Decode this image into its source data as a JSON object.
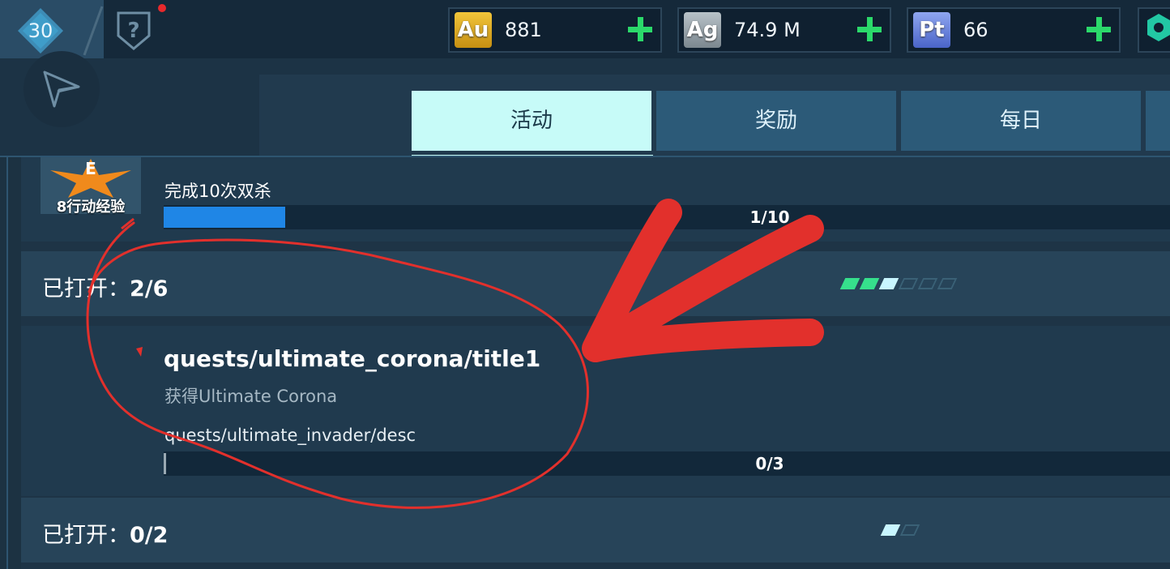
{
  "player": {
    "level": "30"
  },
  "resources": [
    {
      "symbol": "Au",
      "value": "881",
      "color": "#d6a51b"
    },
    {
      "symbol": "Ag",
      "value": "74.9 M",
      "color": "#8e9aa3"
    },
    {
      "symbol": "Pt",
      "value": "66",
      "color": "#5c7de0"
    }
  ],
  "tabs": [
    {
      "label": "活动",
      "active": true
    },
    {
      "label": "奖励",
      "active": false
    },
    {
      "label": "每日",
      "active": false
    }
  ],
  "task1": {
    "reward_label": "8行动经验",
    "reward_grade": "E",
    "title": "完成10次双杀",
    "progress_text": "1/10",
    "progress": 0.1
  },
  "section1": {
    "label": "已打开：",
    "count": "2/6",
    "pips": [
      "on",
      "on",
      "half",
      "off",
      "off",
      "off"
    ]
  },
  "quest": {
    "title": "quests/ultimate_corona/title1",
    "subtitle": "获得Ultimate Corona",
    "desc": "quests/ultimate_invader/desc",
    "progress_text": "0/3",
    "progress": 0
  },
  "section2": {
    "label": "已打开：",
    "count": "0/2",
    "pips": [
      "half",
      "off"
    ]
  },
  "colors": {
    "accent": "#c7fbf8",
    "progress": "#1f86e6",
    "plus": "#2bd96a",
    "annotation": "#e2302c"
  }
}
